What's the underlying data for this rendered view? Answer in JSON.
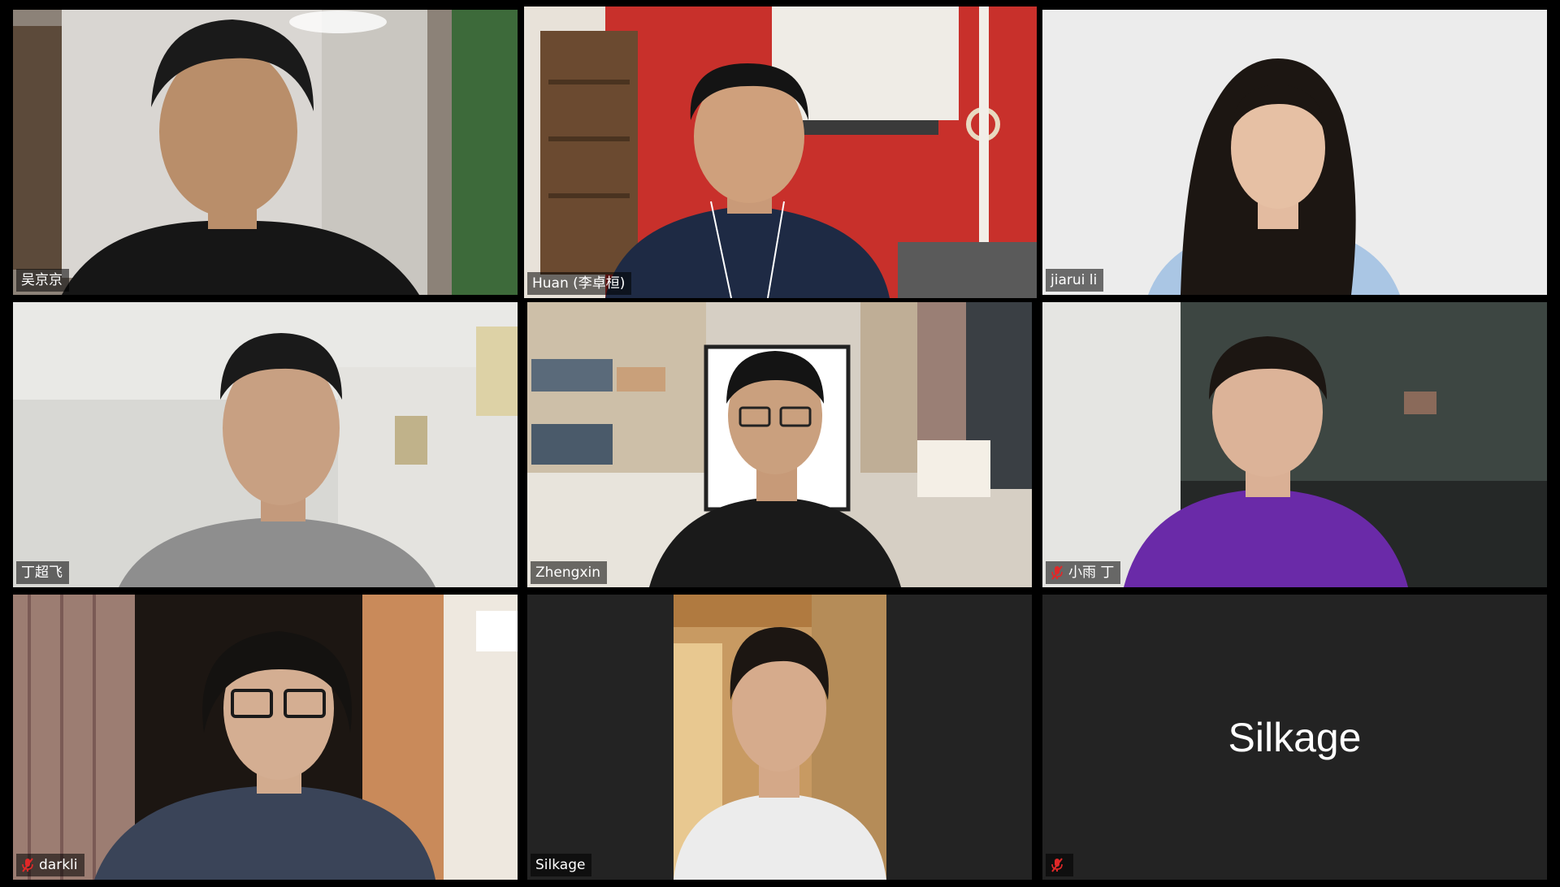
{
  "meeting": {
    "participants": [
      {
        "name": "吴京京",
        "muted": false,
        "active": false,
        "video": true
      },
      {
        "name": "Huan (李卓桓)",
        "muted": false,
        "active": true,
        "video": true
      },
      {
        "name": "jiarui li",
        "muted": false,
        "active": false,
        "video": true
      },
      {
        "name": "丁超飞",
        "muted": false,
        "active": false,
        "video": true
      },
      {
        "name": "Zhengxin",
        "muted": false,
        "active": false,
        "video": true
      },
      {
        "name": "小雨 丁",
        "muted": true,
        "active": false,
        "video": true
      },
      {
        "name": "darkli",
        "muted": true,
        "active": false,
        "video": true
      },
      {
        "name": "Silkage",
        "muted": false,
        "active": false,
        "video": true
      },
      {
        "name": "",
        "muted": true,
        "active": false,
        "video": false,
        "display_name": "Silkage"
      }
    ]
  },
  "colors": {
    "active_speaker_border": "#d8eb8f",
    "tile_background": "#232323",
    "muted_icon": "#e02828"
  },
  "icons": {
    "muted": "mic-muted-icon"
  }
}
